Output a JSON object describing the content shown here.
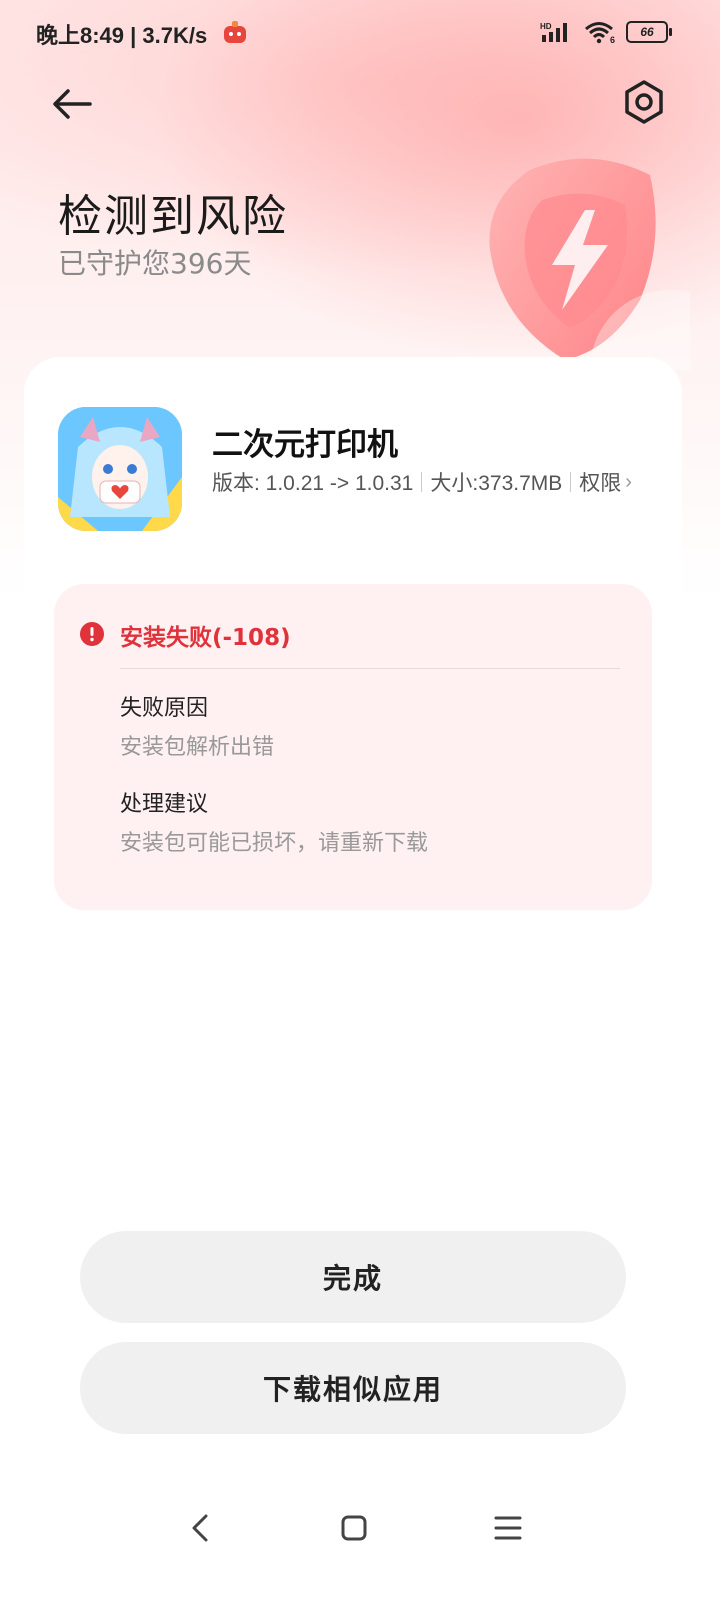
{
  "status_bar": {
    "time": "晚上8:49 | 3.7K/s",
    "network": "HD",
    "wifi_badge": "6",
    "battery": "66"
  },
  "header": {
    "title": "检测到风险",
    "subtitle": "已守护您396天"
  },
  "app": {
    "name": "二次元打印机",
    "version": "版本: 1.0.21 -> 1.0.31",
    "size": "大小:373.7MB",
    "permissions": "权限"
  },
  "error": {
    "title": "安装失败(-108)",
    "reason_label": "失败原因",
    "reason_value": "安装包解析出错",
    "suggestion_label": "处理建议",
    "suggestion_value": "安装包可能已损坏，请重新下载"
  },
  "actions": {
    "done": "完成",
    "download_similar": "下载相似应用"
  },
  "colors": {
    "error_red": "#e0323a",
    "panel_bg": "#fff1f1",
    "button_bg": "#f0f0f0"
  },
  "icons": {
    "back": "arrow-left-icon",
    "settings": "settings-hexagon-icon",
    "shield": "shield-lightning-icon",
    "error": "exclamation-circle-icon",
    "nav_back": "chevron-left-icon",
    "nav_home": "square-icon",
    "nav_menu": "hamburger-icon"
  }
}
